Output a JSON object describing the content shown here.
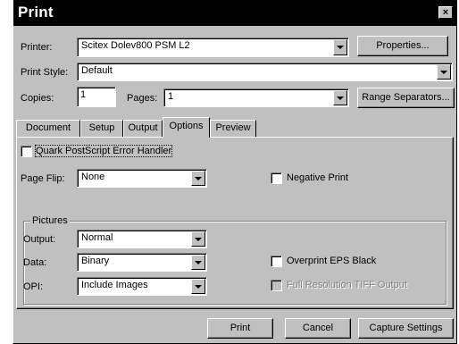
{
  "window": {
    "title": "Print",
    "close_glyph": "×"
  },
  "printer": {
    "label": "Printer:",
    "value": "Scitex Dolev800 PSM L2",
    "properties_button": "Properties..."
  },
  "print_style": {
    "label": "Print Style:",
    "value": "Default"
  },
  "copies": {
    "label": "Copies:",
    "value": "1"
  },
  "pages": {
    "label": "Pages:",
    "value": "1",
    "range_button": "Range Separators..."
  },
  "tabs": [
    {
      "label": "Document",
      "active": false
    },
    {
      "label": "Setup",
      "active": false
    },
    {
      "label": "Output",
      "active": false
    },
    {
      "label": "Options",
      "active": true
    },
    {
      "label": "Preview",
      "active": false
    }
  ],
  "options": {
    "quark_error_handler": {
      "label": "Quark PostScript Error Handler",
      "checked": false
    },
    "page_flip": {
      "label": "Page Flip:",
      "value": "None"
    },
    "negative_print": {
      "label": "Negative Print",
      "checked": false
    },
    "pictures": {
      "title": "Pictures",
      "output": {
        "label": "Output:",
        "value": "Normal"
      },
      "data": {
        "label": "Data:",
        "value": "Binary"
      },
      "opi": {
        "label": "OPI:",
        "value": "Include Images"
      },
      "overprint_eps_black": {
        "label": "Overprint EPS Black",
        "checked": false
      },
      "full_resolution_tiff": {
        "label": "Full Resolution TIFF Output",
        "checked": false,
        "disabled": true
      }
    }
  },
  "footer": {
    "print_button": "Print",
    "cancel_button": "Cancel",
    "capture_button": "Capture Settings"
  }
}
